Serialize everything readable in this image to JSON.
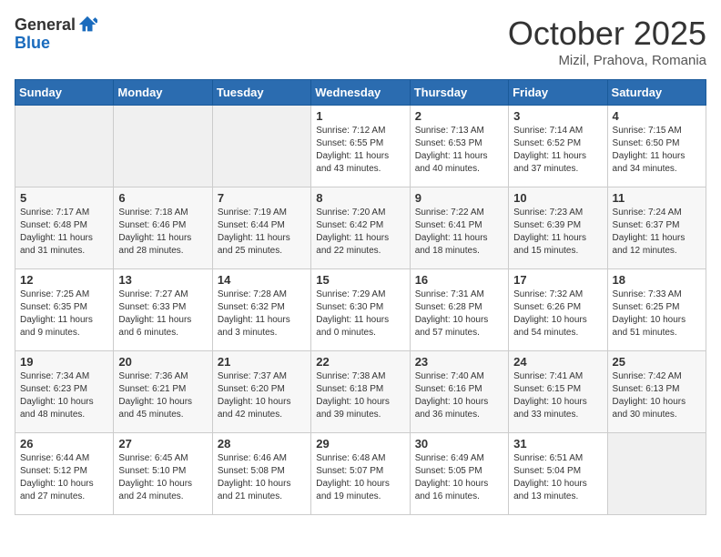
{
  "header": {
    "logo_general": "General",
    "logo_blue": "Blue",
    "month": "October 2025",
    "location": "Mizil, Prahova, Romania"
  },
  "days_of_week": [
    "Sunday",
    "Monday",
    "Tuesday",
    "Wednesday",
    "Thursday",
    "Friday",
    "Saturday"
  ],
  "weeks": [
    [
      {
        "num": "",
        "detail": ""
      },
      {
        "num": "",
        "detail": ""
      },
      {
        "num": "",
        "detail": ""
      },
      {
        "num": "1",
        "detail": "Sunrise: 7:12 AM\nSunset: 6:55 PM\nDaylight: 11 hours and 43 minutes."
      },
      {
        "num": "2",
        "detail": "Sunrise: 7:13 AM\nSunset: 6:53 PM\nDaylight: 11 hours and 40 minutes."
      },
      {
        "num": "3",
        "detail": "Sunrise: 7:14 AM\nSunset: 6:52 PM\nDaylight: 11 hours and 37 minutes."
      },
      {
        "num": "4",
        "detail": "Sunrise: 7:15 AM\nSunset: 6:50 PM\nDaylight: 11 hours and 34 minutes."
      }
    ],
    [
      {
        "num": "5",
        "detail": "Sunrise: 7:17 AM\nSunset: 6:48 PM\nDaylight: 11 hours and 31 minutes."
      },
      {
        "num": "6",
        "detail": "Sunrise: 7:18 AM\nSunset: 6:46 PM\nDaylight: 11 hours and 28 minutes."
      },
      {
        "num": "7",
        "detail": "Sunrise: 7:19 AM\nSunset: 6:44 PM\nDaylight: 11 hours and 25 minutes."
      },
      {
        "num": "8",
        "detail": "Sunrise: 7:20 AM\nSunset: 6:42 PM\nDaylight: 11 hours and 22 minutes."
      },
      {
        "num": "9",
        "detail": "Sunrise: 7:22 AM\nSunset: 6:41 PM\nDaylight: 11 hours and 18 minutes."
      },
      {
        "num": "10",
        "detail": "Sunrise: 7:23 AM\nSunset: 6:39 PM\nDaylight: 11 hours and 15 minutes."
      },
      {
        "num": "11",
        "detail": "Sunrise: 7:24 AM\nSunset: 6:37 PM\nDaylight: 11 hours and 12 minutes."
      }
    ],
    [
      {
        "num": "12",
        "detail": "Sunrise: 7:25 AM\nSunset: 6:35 PM\nDaylight: 11 hours and 9 minutes."
      },
      {
        "num": "13",
        "detail": "Sunrise: 7:27 AM\nSunset: 6:33 PM\nDaylight: 11 hours and 6 minutes."
      },
      {
        "num": "14",
        "detail": "Sunrise: 7:28 AM\nSunset: 6:32 PM\nDaylight: 11 hours and 3 minutes."
      },
      {
        "num": "15",
        "detail": "Sunrise: 7:29 AM\nSunset: 6:30 PM\nDaylight: 11 hours and 0 minutes."
      },
      {
        "num": "16",
        "detail": "Sunrise: 7:31 AM\nSunset: 6:28 PM\nDaylight: 10 hours and 57 minutes."
      },
      {
        "num": "17",
        "detail": "Sunrise: 7:32 AM\nSunset: 6:26 PM\nDaylight: 10 hours and 54 minutes."
      },
      {
        "num": "18",
        "detail": "Sunrise: 7:33 AM\nSunset: 6:25 PM\nDaylight: 10 hours and 51 minutes."
      }
    ],
    [
      {
        "num": "19",
        "detail": "Sunrise: 7:34 AM\nSunset: 6:23 PM\nDaylight: 10 hours and 48 minutes."
      },
      {
        "num": "20",
        "detail": "Sunrise: 7:36 AM\nSunset: 6:21 PM\nDaylight: 10 hours and 45 minutes."
      },
      {
        "num": "21",
        "detail": "Sunrise: 7:37 AM\nSunset: 6:20 PM\nDaylight: 10 hours and 42 minutes."
      },
      {
        "num": "22",
        "detail": "Sunrise: 7:38 AM\nSunset: 6:18 PM\nDaylight: 10 hours and 39 minutes."
      },
      {
        "num": "23",
        "detail": "Sunrise: 7:40 AM\nSunset: 6:16 PM\nDaylight: 10 hours and 36 minutes."
      },
      {
        "num": "24",
        "detail": "Sunrise: 7:41 AM\nSunset: 6:15 PM\nDaylight: 10 hours and 33 minutes."
      },
      {
        "num": "25",
        "detail": "Sunrise: 7:42 AM\nSunset: 6:13 PM\nDaylight: 10 hours and 30 minutes."
      }
    ],
    [
      {
        "num": "26",
        "detail": "Sunrise: 6:44 AM\nSunset: 5:12 PM\nDaylight: 10 hours and 27 minutes."
      },
      {
        "num": "27",
        "detail": "Sunrise: 6:45 AM\nSunset: 5:10 PM\nDaylight: 10 hours and 24 minutes."
      },
      {
        "num": "28",
        "detail": "Sunrise: 6:46 AM\nSunset: 5:08 PM\nDaylight: 10 hours and 21 minutes."
      },
      {
        "num": "29",
        "detail": "Sunrise: 6:48 AM\nSunset: 5:07 PM\nDaylight: 10 hours and 19 minutes."
      },
      {
        "num": "30",
        "detail": "Sunrise: 6:49 AM\nSunset: 5:05 PM\nDaylight: 10 hours and 16 minutes."
      },
      {
        "num": "31",
        "detail": "Sunrise: 6:51 AM\nSunset: 5:04 PM\nDaylight: 10 hours and 13 minutes."
      },
      {
        "num": "",
        "detail": ""
      }
    ]
  ]
}
